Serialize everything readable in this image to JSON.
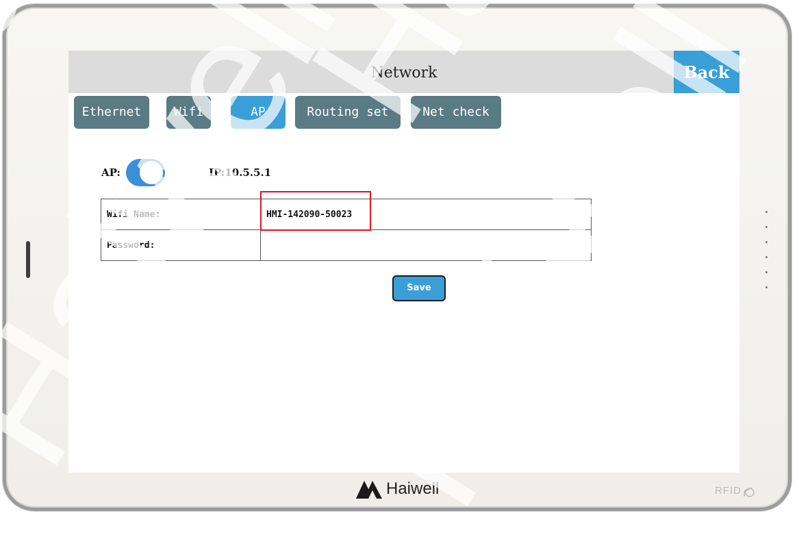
{
  "header": {
    "title": "Network",
    "back_label": "Back"
  },
  "tabs": [
    {
      "label": "Ethernet",
      "active": false
    },
    {
      "label": "Wifi",
      "active": false
    },
    {
      "label": "AP",
      "active": true
    },
    {
      "label": "Routing set",
      "active": false
    },
    {
      "label": "Net check",
      "active": false
    }
  ],
  "ap": {
    "label": "AP:",
    "enabled": true,
    "ip_text": "IP:10.5.5.1"
  },
  "settings": {
    "wifi_name_label": "Wifi Name:",
    "wifi_name_value": "HMI-142090-50023",
    "password_label": "Password:",
    "password_value": ""
  },
  "save_label": "Save",
  "device": {
    "brand": "Haiwell",
    "rfid_label": "RFID"
  },
  "watermark": "Haiwell",
  "colors": {
    "accent": "#3a9fd8",
    "tab_inactive": "#5a7a84",
    "header_bg": "#dcdcdc",
    "highlight": "#e0141e"
  },
  "icons": [
    "haiwell-logo-icon",
    "nfc-icon",
    "toggle-switch"
  ]
}
